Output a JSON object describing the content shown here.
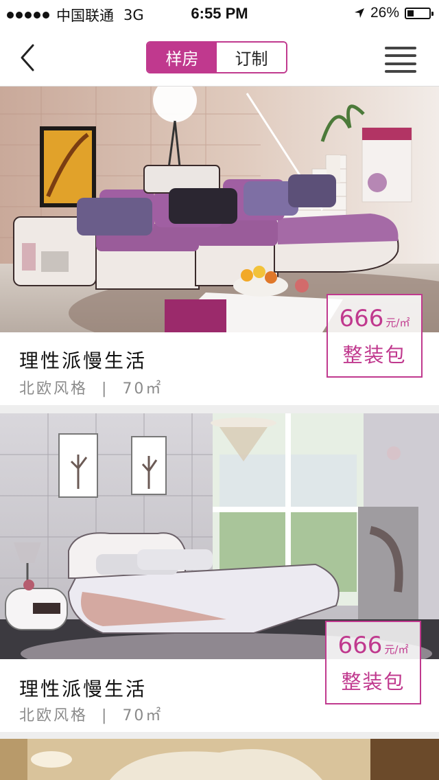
{
  "status_bar": {
    "carrier": "中国联通",
    "network": "3G",
    "time": "6:55 PM",
    "battery": "26%",
    "battery_level": 0.26
  },
  "nav": {
    "tabs": [
      {
        "label": "样房",
        "active": true
      },
      {
        "label": "订制",
        "active": false
      }
    ]
  },
  "colors": {
    "accent": "#c0398e",
    "subtitle": "#8a8a8a"
  },
  "listings": [
    {
      "title": "理性派慢生活",
      "style": "北欧风格",
      "separator": "|",
      "area": "70㎡",
      "price": "666",
      "unit": "元/㎡",
      "package": "整装包"
    },
    {
      "title": "理性派慢生活",
      "style": "北欧风格",
      "separator": "|",
      "area": "70㎡",
      "price": "666",
      "unit": "元/㎡",
      "package": "整装包"
    }
  ]
}
